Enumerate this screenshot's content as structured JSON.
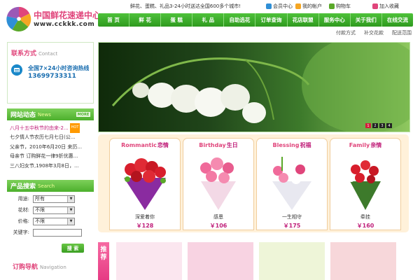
{
  "header": {
    "logo_cn": "中国鲜花速递中心",
    "logo_url": "www.cckkk.com",
    "tagline": "鲜花、蛋糕、礼品3-24小时送达全国600多个城市!",
    "top_links": [
      {
        "label": "会员中心",
        "color": "#2f8fd6"
      },
      {
        "label": "我的帐户",
        "color": "#f5a623"
      },
      {
        "label": "购物车",
        "color": "#5aa829"
      },
      {
        "label": "加入收藏",
        "color": "#e0457b"
      }
    ]
  },
  "nav": {
    "items": [
      "首  页",
      "鲜  花",
      "蛋  糕",
      "礼  品",
      "自助选花",
      "订单查询",
      "花店联盟",
      "服务中心",
      "关于我们",
      "在线交流"
    ]
  },
  "subnav": [
    "付款方式",
    "补交花款",
    "配送范围"
  ],
  "sidebar": {
    "contact": {
      "title": "联系方式",
      "title_en": "Contact",
      "hotline_label": "全国7×24小时咨询热线",
      "hotline_number": "13699733311"
    },
    "news": {
      "title": "网站动态",
      "title_en": "News",
      "more_label": "MORE",
      "hot_label": "HOT",
      "items": [
        "八月十五中秋节的由来-2...",
        "七夕情人节农历七月七日(公...",
        "父亲节，2010年6月20日 来历...",
        "母亲节 订购鲜花一律9折优惠...",
        "三八妇女节,1908年3月8日，..."
      ]
    },
    "search": {
      "title": "产品搜索",
      "title_en": "Search",
      "fields": [
        {
          "label": "用途:",
          "value": "所有"
        },
        {
          "label": "花材:",
          "value": "不限"
        },
        {
          "label": "价格:",
          "value": "不限"
        }
      ],
      "keyword_label": "关键字:",
      "button_label": "搜 索"
    },
    "order_nav": {
      "title": "订购导航",
      "title_en": "Navigation"
    }
  },
  "banner": {
    "dots": [
      "1",
      "2",
      "3",
      "4"
    ],
    "active_index": 0
  },
  "categories": [
    {
      "en": "Rommantic",
      "cn": "恋情",
      "product": "深爱着你",
      "price": "￥128"
    },
    {
      "en": "Birthday",
      "cn": "生日",
      "product": "感恩",
      "price": "￥106"
    },
    {
      "en": "Blessing",
      "cn": "祝福",
      "product": "一生相守",
      "price": "￥175"
    },
    {
      "en": "Family",
      "cn": "亲情",
      "product": "牵挂",
      "price": "￥160"
    }
  ],
  "recommend": {
    "label_chars": [
      "推",
      "荐"
    ]
  }
}
